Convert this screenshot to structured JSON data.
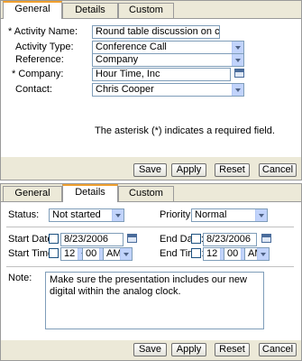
{
  "tabs": [
    "General",
    "Details",
    "Custom"
  ],
  "general": {
    "activity_name_label": "* Activity Name:",
    "activity_name_value": "Round table discussion on clocks,..|",
    "activity_type_label": "Activity Type:",
    "activity_type_value": "Conference Call",
    "reference_label": "Reference:",
    "reference_value": "Company",
    "company_label": "* Company:",
    "company_value": "Hour Time, Inc",
    "contact_label": "Contact:",
    "contact_value": "Chris Cooper",
    "required_note": "The asterisk (*) indicates a required field."
  },
  "details": {
    "status_label": "Status:",
    "status_value": "Not started",
    "priority_label": "Priority:",
    "priority_value": "Normal",
    "start_date_label": "Start Date:",
    "start_date_value": "8/23/2006",
    "end_date_label": "End Date:",
    "end_date_value": "8/23/2006",
    "start_time_label": "Start Time:",
    "end_time_label": "End Time:",
    "start_hour": "12",
    "start_min": "00",
    "start_ampm": "AM",
    "end_hour": "12",
    "end_min": "00",
    "end_ampm": "AM",
    "note_label": "Note:",
    "note_value": "Make sure the presentation includes our new digital within the analog clock."
  },
  "buttons": {
    "save": "Save",
    "apply": "Apply",
    "reset": "Reset",
    "cancel": "Cancel"
  },
  "colors": {
    "active_tab_accent": "#f0a030",
    "panel_background": "#ece9d8",
    "field_border": "#7f9db9"
  }
}
